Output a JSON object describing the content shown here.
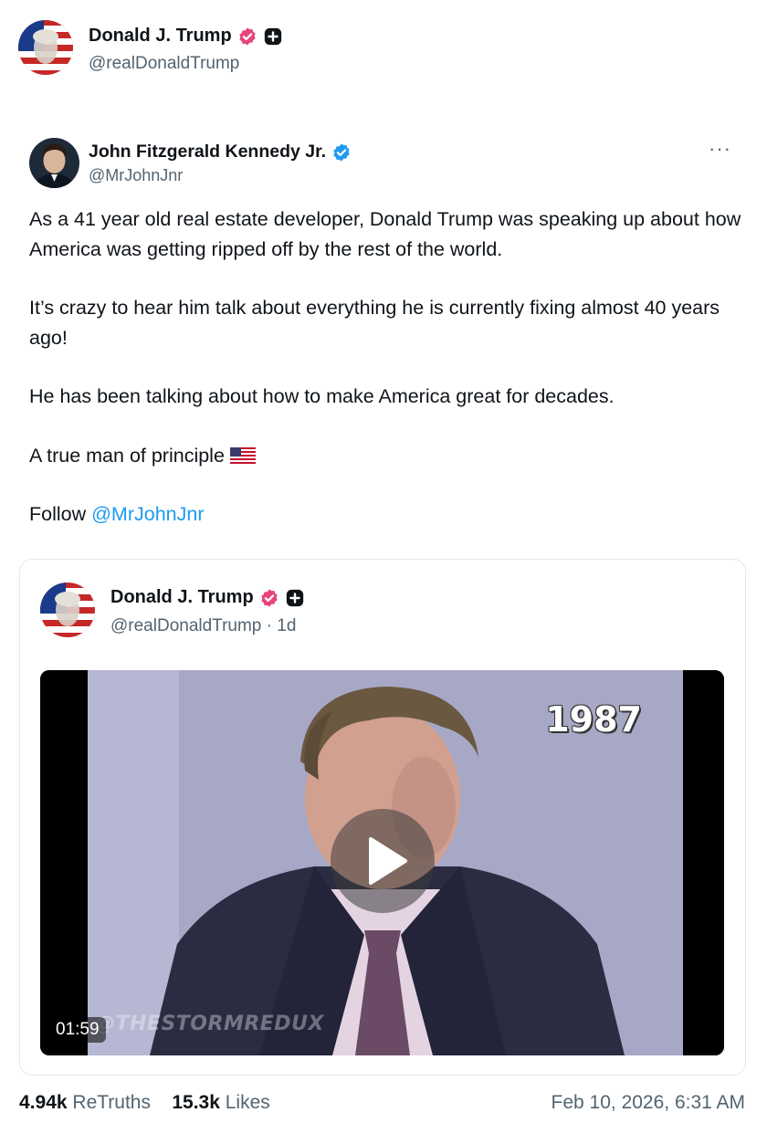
{
  "author": {
    "name": "Donald J. Trump",
    "handle": "@realDonaldTrump"
  },
  "post": {
    "author_name": "John Fitzgerald Kennedy Jr.",
    "author_handle": "@MrJohnJnr",
    "more_label": "···",
    "paragraphs": [
      "As a 41 year old real estate developer, Donald Trump was speaking up about how America was getting ripped off by the rest of the world.",
      "It’s crazy to hear him talk about everything he is currently fixing almost 40 years ago!",
      "He has been talking about how to make America great for decades.",
      "A true man of principle"
    ],
    "follow_prefix": "Follow ",
    "follow_mention": "@MrJohnJnr"
  },
  "quote": {
    "author_name": "Donald J. Trump",
    "author_handle": "@realDonaldTrump · 1d",
    "video": {
      "year_overlay": "1987",
      "duration": "01:59",
      "watermark": "@THESTORMREDUX"
    }
  },
  "stats": {
    "retruths_count": "4.94k",
    "retruths_label": "ReTruths",
    "likes_count": "15.3k",
    "likes_label": "Likes",
    "timestamp": "Feb 10, 2026, 6:31 AM"
  },
  "icons": {
    "verified_trump": "verified-badge-icon",
    "plus_badge": "plus-badge-icon",
    "verified_jfk": "verified-badge-icon",
    "play": "play-icon",
    "flag": "us-flag-emoji"
  },
  "colors": {
    "link": "#1d9bf0",
    "verified_red": "#e6447a",
    "verified_blue": "#1d9bf0",
    "muted": "#536471"
  }
}
